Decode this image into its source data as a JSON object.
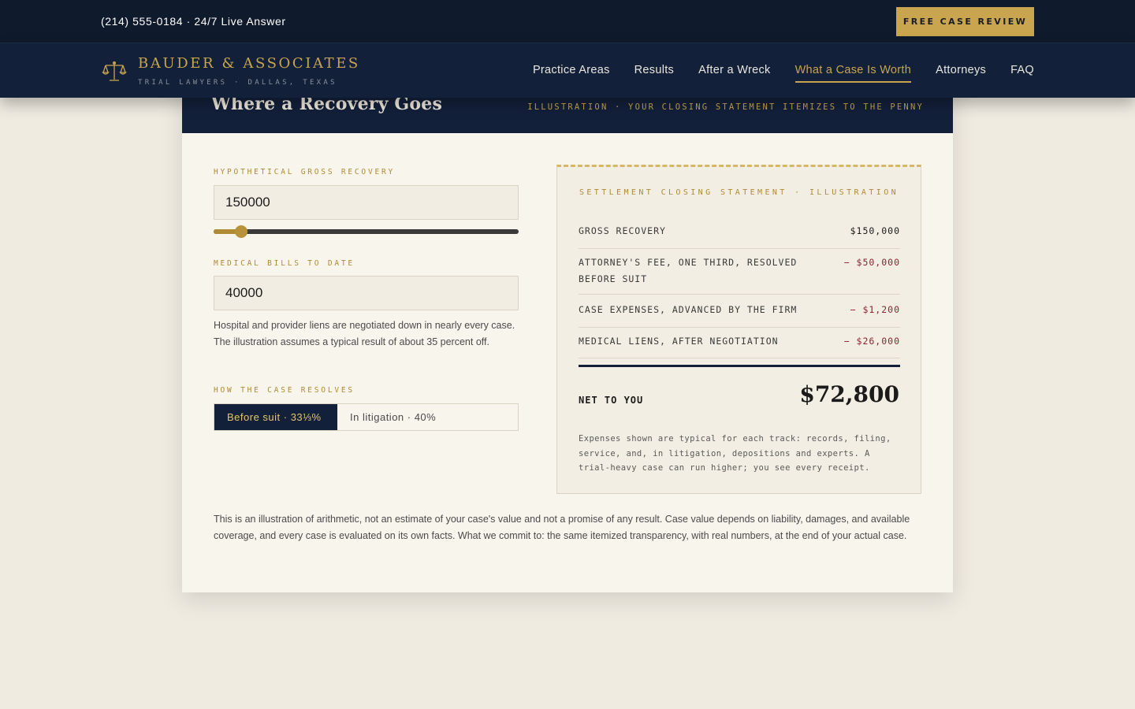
{
  "utility_bar": {
    "phone_text": "(214) 555-0184 · 24/7 Live Answer",
    "cta_label": "FREE CASE REVIEW"
  },
  "brand": {
    "name": "BAUDER & ASSOCIATES",
    "tagline": "TRIAL LAWYERS · DALLAS, TEXAS",
    "icon": "scales-of-justice-icon",
    "accent_color": "#c8a54e"
  },
  "nav": {
    "items": [
      {
        "label": "Practice Areas"
      },
      {
        "label": "Results"
      },
      {
        "label": "After a Wreck"
      },
      {
        "label": "What a Case Is Worth"
      },
      {
        "label": "Attorneys"
      },
      {
        "label": "FAQ"
      }
    ],
    "active_item": "What a Case Is Worth"
  },
  "card": {
    "title": "Where a Recovery Goes",
    "subtitle": "ILLUSTRATION · YOUR CLOSING STATEMENT ITEMIZES TO THE PENNY"
  },
  "calculator": {
    "gross_label": "HYPOTHETICAL GROSS RECOVERY",
    "gross_value": "150000",
    "gross_slider_fraction": 0.09,
    "medical_label": "MEDICAL BILLS TO DATE",
    "medical_value": "40000",
    "medical_help": "Hospital and provider liens are negotiated down in nearly every case. The illustration assumes a typical result of about 35 percent off.",
    "resolve_label": "HOW THE CASE RESOLVES",
    "resolve_options": [
      {
        "label": "Before suit · 33⅓%"
      },
      {
        "label": "In litigation · 40%"
      }
    ],
    "resolve_selected": "Before suit · 33⅓%"
  },
  "statement": {
    "heading": "SETTLEMENT CLOSING STATEMENT · ILLUSTRATION",
    "rows": [
      {
        "label": "GROSS RECOVERY",
        "amount": "$150,000"
      },
      {
        "label": "ATTORNEY'S FEE, ONE THIRD, RESOLVED BEFORE SUIT",
        "amount": "− $50,000"
      },
      {
        "label": "CASE EXPENSES, ADVANCED BY THE FIRM",
        "amount": "− $1,200"
      },
      {
        "label": "MEDICAL LIENS, AFTER NEGOTIATION",
        "amount": "− $26,000"
      }
    ],
    "net_label": "NET TO YOU",
    "net_amount": "$72,800",
    "note": "Expenses shown are typical for each track: records, filing, service, and, in litigation, depositions and experts. A trial-heavy case can run higher; you see every receipt."
  },
  "disclaimer": "This is an illustration of arithmetic, not an estimate of your case's value and not a promise of any result. Case value depends on liability, damages, and available coverage, and every case is evaluated on its own facts. What we commit to: the same itemized transparency, with real numbers, at the end of your actual case."
}
